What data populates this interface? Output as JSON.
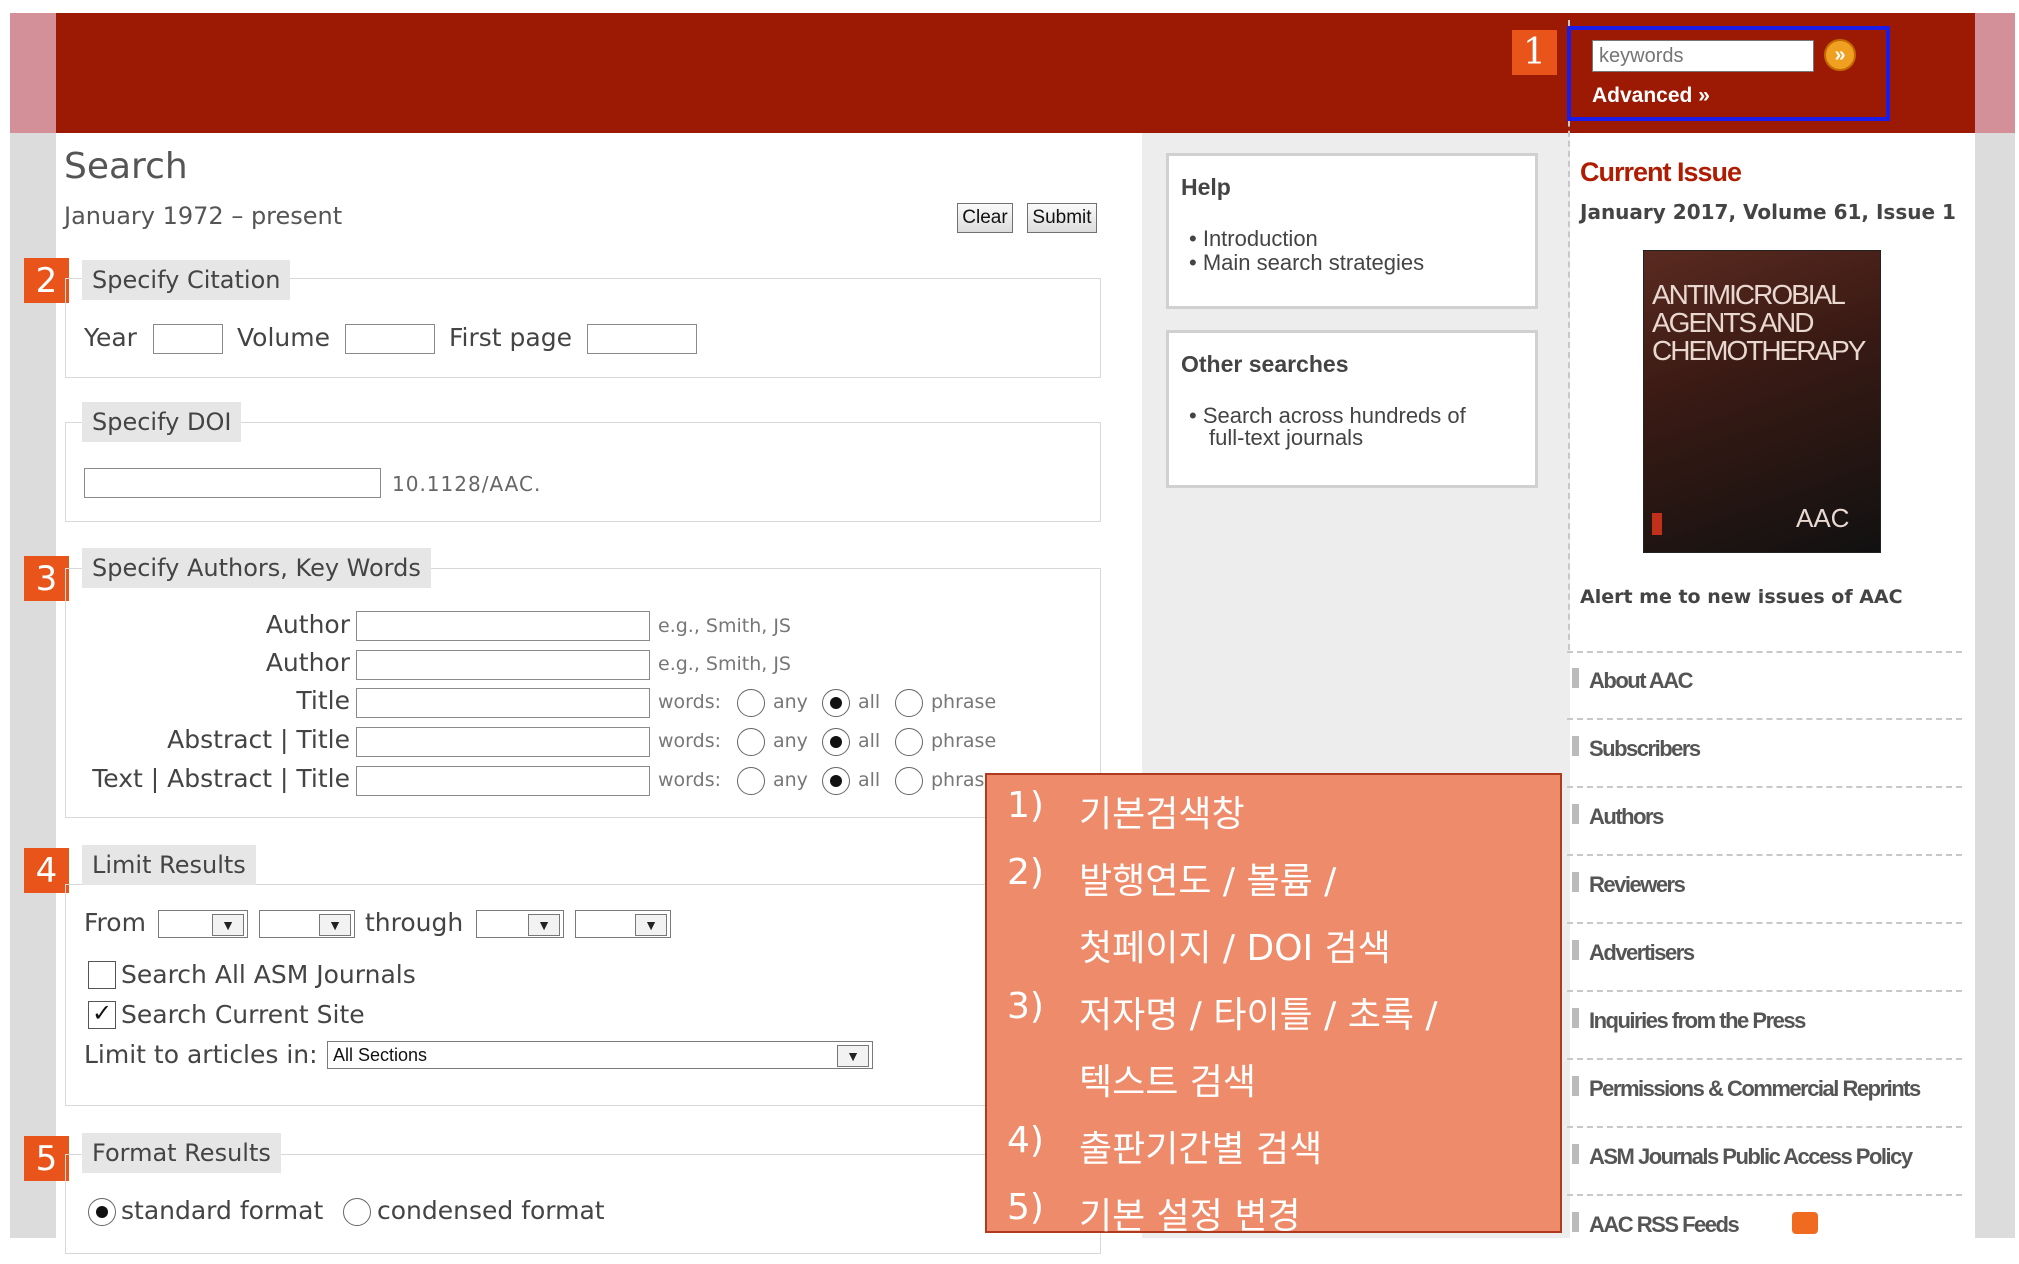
{
  "header": {
    "search_placeholder": "keywords",
    "advanced_label": "Advanced »",
    "go_symbol": "»"
  },
  "markers": [
    "1",
    "2",
    "3",
    "4",
    "5"
  ],
  "search": {
    "title": "Search",
    "subtitle": "January 1972 – present",
    "clear_label": "Clear",
    "submit_label": "Submit"
  },
  "citation": {
    "legend": "Specify Citation",
    "year_label": "Year",
    "volume_label": "Volume",
    "first_page_label": "First page"
  },
  "doi": {
    "legend": "Specify DOI",
    "prefix": "10.1128/AAC."
  },
  "authors": {
    "legend": "Specify Authors, Key Words",
    "rows": [
      {
        "label": "Author",
        "hint": "e.g., Smith, JS"
      },
      {
        "label": "Author",
        "hint": "e.g., Smith, JS"
      },
      {
        "label": "Title",
        "hint": "words:"
      },
      {
        "label": "Abstract | Title",
        "hint": "words:"
      },
      {
        "label": "Text | Abstract | Title",
        "hint": "words:"
      }
    ],
    "radio_any": "any",
    "radio_all": "all",
    "radio_phrase": "phrase",
    "radio_phrase_cut": "phras"
  },
  "limit": {
    "legend": "Limit Results",
    "from_label": "From",
    "through_label": "through",
    "all_asm_label": "Search All ASM Journals",
    "all_asm_checked": false,
    "current_site_label": "Search Current Site",
    "current_site_checked": true,
    "limit_to_label": "Limit to articles in:",
    "limit_to_value": "All Sections"
  },
  "format": {
    "legend": "Format Results",
    "standard_label": "standard format",
    "condensed_label": "condensed format",
    "selected": "standard"
  },
  "help": {
    "title": "Help",
    "items": [
      "Introduction",
      "Main search strategies"
    ]
  },
  "other": {
    "title": "Other searches",
    "item_line1": "Search across hundreds of",
    "item_line2": "full-text journals"
  },
  "current_issue": {
    "heading": "Current Issue",
    "date": "January 2017, Volume 61, Issue 1",
    "cover_title_lines": [
      "ANTIMICROBIAL",
      "AGENTS AND",
      "CHEMOTHERAPY"
    ],
    "cover_abbrev": "AAC",
    "alert_text": "Alert me to new issues of AAC"
  },
  "sidebar_links": [
    "About AAC",
    "Subscribers",
    "Authors",
    "Reviewers",
    "Advertisers",
    "Inquiries from the Press",
    "Permissions & Commercial Reprints",
    "ASM Journals Public Access Policy",
    "AAC RSS Feeds"
  ],
  "annotation": {
    "lines": [
      {
        "num": "1)",
        "text": "기본검색창"
      },
      {
        "num": "2)",
        "text": "발행연도 / 볼륨 /"
      },
      {
        "num": "",
        "text": "첫페이지 / DOI 검색"
      },
      {
        "num": "3)",
        "text": "저자명 / 타이틀 / 초록 /"
      },
      {
        "num": "",
        "text": "텍스트 검색"
      },
      {
        "num": "4)",
        "text": "출판기간별 검색"
      },
      {
        "num": "5)",
        "text": "기본 설정 변경"
      }
    ]
  },
  "colors": {
    "header_bg": "#9c1a03",
    "marker_bg": "#e8541a",
    "highlight_border": "#1c1ce8",
    "annotation_bg": "#ee8b6a",
    "issue_heading": "#b01c02"
  }
}
